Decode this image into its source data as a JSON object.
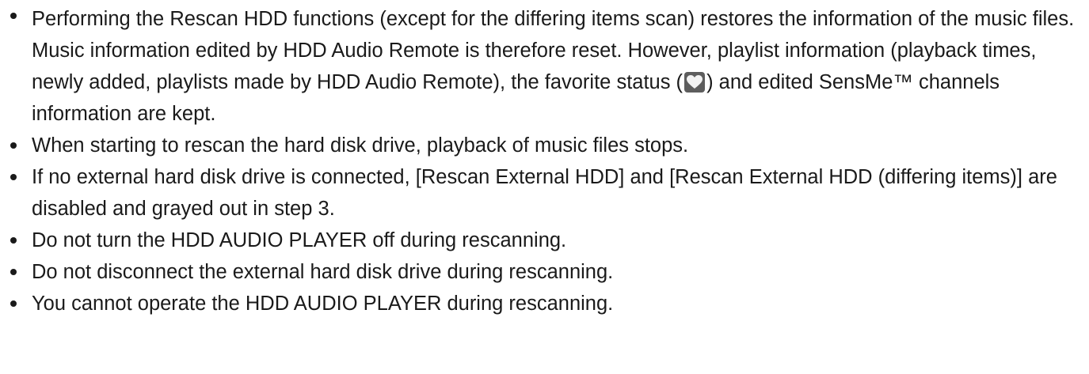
{
  "notes": {
    "item1": {
      "before_icon": "Performing the Rescan HDD functions (except for the differing items scan) restores the information of the music files. Music information edited by HDD Audio Remote is therefore reset. However, playlist information (playback times, newly added, playlists made by HDD Audio Remote), the favorite status (",
      "icon": "favorite-heart-icon",
      "after_icon": ") and edited SensMe™ channels information are kept."
    },
    "item2": "When starting to rescan the hard disk drive, playback of music files stops.",
    "item3": "If no external hard disk drive is connected, [Rescan External HDD] and [Rescan External HDD (differing items)] are disabled and grayed out in step 3.",
    "item4": "Do not turn the HDD AUDIO PLAYER off during rescanning.",
    "item5": "Do not disconnect the external hard disk drive during rescanning.",
    "item6": "You cannot operate the HDD AUDIO PLAYER during rescanning."
  },
  "colors": {
    "text": "#1a1a1a",
    "icon_bg": "#5d5d5d",
    "icon_heart": "#ffffff"
  }
}
